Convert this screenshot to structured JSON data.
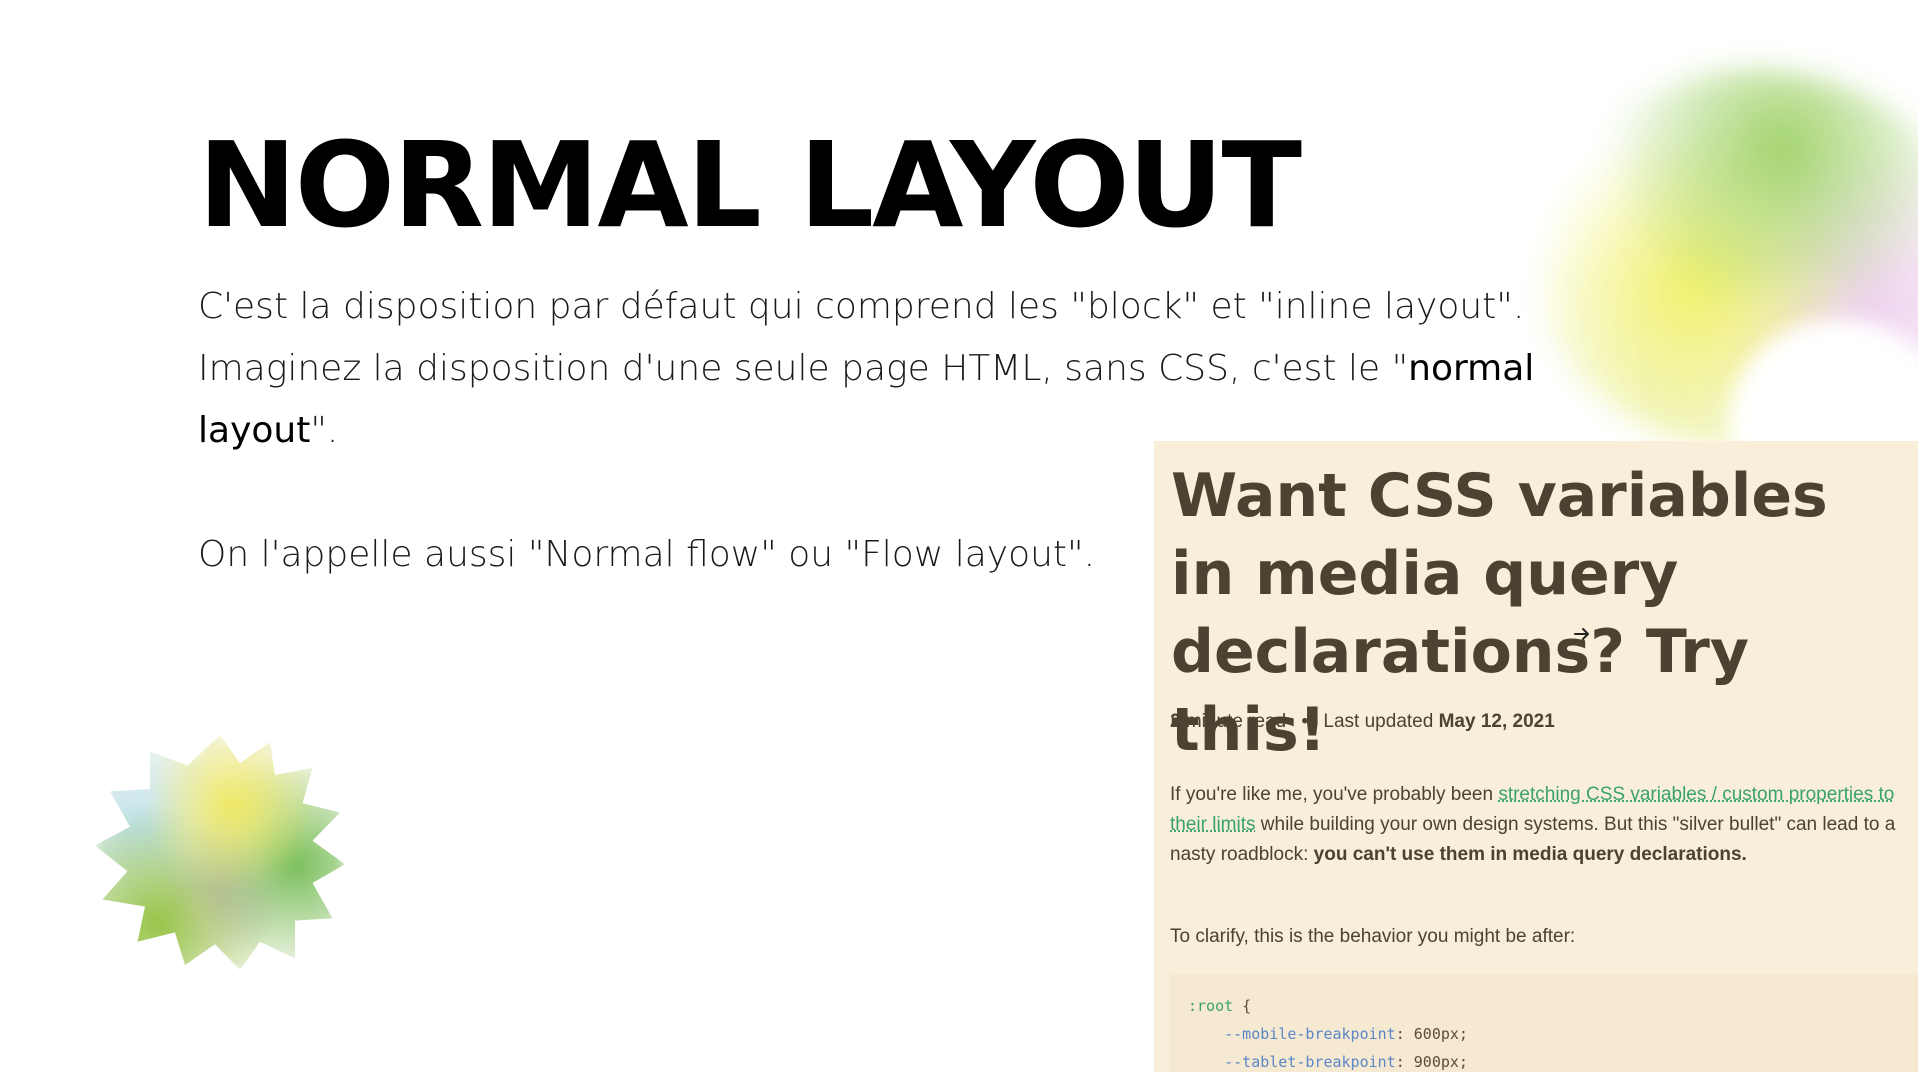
{
  "slide": {
    "title": "NORMAL LAYOUT",
    "paragraph_1_part1": "C'est la disposition par défaut qui comprend les \"block\" et \"inline layout\". Imaginez la disposition d'une seule page HTML, sans CSS, c'est le \"",
    "paragraph_1_bold": "normal layout",
    "paragraph_1_part2": "\".",
    "paragraph_2": "On l'appelle aussi \"Normal flow\" ou \"Flow layout\"."
  },
  "article": {
    "title": "Want CSS variables in media query declarations? Try this!",
    "read_time_number": "2",
    "read_time_label": "minute read",
    "separator": "•",
    "last_updated_label": "Last updated",
    "last_updated_date": "May 12, 2021",
    "body_intro": "If you're like me, you've probably been ",
    "body_link": "stretching CSS variables / custom properties to their limits",
    "body_middle": " while building your own design systems. But this \"silver bullet\" can lead to a nasty roadblock: ",
    "body_bold": "you can't use them in media query declarations.",
    "clarify": "To clarify, this is the behavior you might be after:",
    "code": {
      "line1_selector": ":root",
      "line1_brace": " {",
      "line2_prop": "--mobile-breakpoint",
      "line2_value": ": 600px;",
      "line3_prop": "--tablet-breakpoint",
      "line3_value": ": 900px;"
    }
  },
  "icons": {
    "cursor": "arrow-cursor-icon"
  },
  "colors": {
    "article_background": "#f8eed9",
    "article_text": "#4d4131",
    "link": "#3aa26f",
    "code_property": "#5b86c8"
  }
}
